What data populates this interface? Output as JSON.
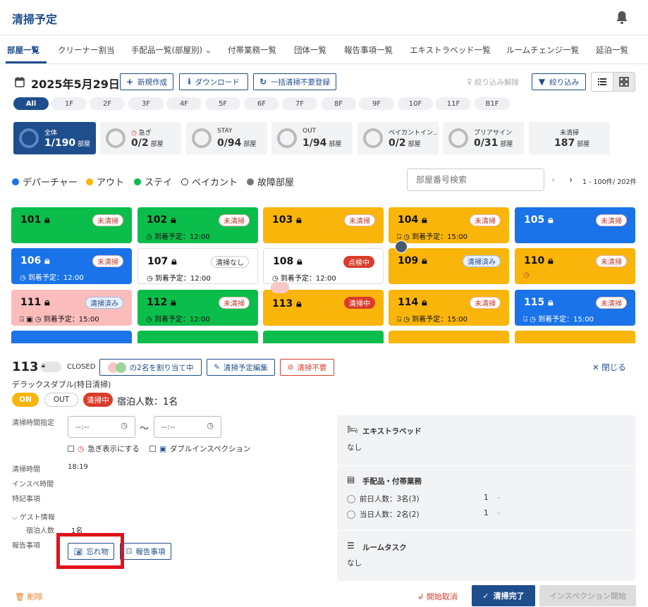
{
  "header": {
    "title": "清掃予定",
    "bell_icon": "bell-icon"
  },
  "tabs": [
    {
      "label": "部屋一覧"
    },
    {
      "label": "クリーナー割当"
    },
    {
      "label": "手配品一覧(部屋別)"
    },
    {
      "label": "付帯業務一覧"
    },
    {
      "label": "団体一覧"
    },
    {
      "label": "報告事項一覧"
    },
    {
      "label": "エキストラベッド一覧"
    },
    {
      "label": "ルームチェンジ一覧"
    },
    {
      "label": "延泊一覧"
    }
  ],
  "toolbar": {
    "date": "2025年5月29日",
    "new_label": "新規作成",
    "download_label": "ダウンロード",
    "bulk_label": "一括清掃不要登録",
    "filter_clear_label": "絞り込み解除",
    "filter_label": "絞り込み"
  },
  "floors": [
    "All",
    "1F",
    "2F",
    "3F",
    "4F",
    "5F",
    "6F",
    "7F",
    "8F",
    "9F",
    "10F",
    "11F",
    "B1F"
  ],
  "stats": [
    {
      "label": "全体",
      "value": "1/190",
      "unit": "部屋"
    },
    {
      "label": "急ぎ",
      "value": "0/2",
      "unit": "部屋"
    },
    {
      "label": "STAY",
      "value": "0/94",
      "unit": "部屋"
    },
    {
      "label": "OUT",
      "value": "1/94",
      "unit": "部屋"
    },
    {
      "label": "ベイカントイン…",
      "value": "0/2",
      "unit": "部屋"
    },
    {
      "label": "プリアサイン",
      "value": "0/31",
      "unit": "部屋"
    },
    {
      "label": "未清掃",
      "value": "187",
      "unit": "部屋"
    }
  ],
  "legend": [
    {
      "label": "デパーチャー",
      "color": "#1a73e8"
    },
    {
      "label": "アウト",
      "color": "#f9b509"
    },
    {
      "label": "ステイ",
      "color": "#0bbd4a"
    },
    {
      "label": "ベイカント",
      "color": "#ffffff"
    },
    {
      "label": "故障部屋",
      "color": "#777777"
    }
  ],
  "search": {
    "placeholder": "部屋番号検索"
  },
  "pager": {
    "label": "1 - 100件/ 202件"
  },
  "rooms": [
    {
      "num": "101",
      "badge": "未清掃",
      "sub": ""
    },
    {
      "num": "102",
      "badge": "未清掃",
      "sub": "到着予定：12:00"
    },
    {
      "num": "103",
      "badge": "未清掃",
      "sub": ""
    },
    {
      "num": "104",
      "badge": "未清掃",
      "sub": "到着予定：15:00"
    },
    {
      "num": "105",
      "badge": "未清掃",
      "sub": ""
    },
    {
      "num": "106",
      "badge": "未清掃",
      "sub": "到着予定：12:00"
    },
    {
      "num": "107",
      "badge": "清掃なし",
      "sub": "到着予定：12:00"
    },
    {
      "num": "108",
      "badge": "点検中",
      "sub": "到着予定：12:00"
    },
    {
      "num": "109",
      "badge": "清掃済み",
      "sub": ""
    },
    {
      "num": "110",
      "badge": "未清掃",
      "sub": ""
    },
    {
      "num": "111",
      "badge": "清掃済み",
      "sub": "到着予定：15:00"
    },
    {
      "num": "112",
      "badge": "未清掃",
      "sub": "到着予定：12:00"
    },
    {
      "num": "113",
      "badge": "清掃中",
      "sub": ""
    },
    {
      "num": "114",
      "badge": "未清掃",
      "sub": "到着予定：15:00"
    },
    {
      "num": "115",
      "badge": "未清掃",
      "sub": "到着予定：15:00"
    }
  ],
  "detail": {
    "room_num": "113",
    "closed_label": "CLOSED",
    "assign_label": "の2名を割り当て中",
    "edit_label": "清掃予定編集",
    "not_needed_label": "清掃不要",
    "close_label": "閉じる",
    "room_type": "デラックスダブル(特日清掃)",
    "on_label": "ON",
    "out_label": "OUT",
    "status_label": "清掃中",
    "guest_count": "宿泊人数：1名",
    "time_label": "清掃時間指定",
    "time_start": "--:--",
    "time_end": "--:--",
    "time_sep": "〜",
    "urgent_label": "急ぎ表示にする",
    "double_label": "ダブルインスペクション",
    "clean_time_label": "清掃時間",
    "clean_time_value": "18:19",
    "inspect_time_label": "インスペ時間",
    "notes_label": "特記事項",
    "guest_info_label": "ゲスト情報",
    "guests_label": "宿泊人数",
    "guests_value": "1名",
    "report_label": "報告事項",
    "lost_label": "忘れ物",
    "report_btn_label": "報告事項"
  },
  "info": {
    "extra_bed_title": "エキストラベッド",
    "extra_bed_value": "なし",
    "supplies_title": "手配品・付帯業務",
    "prev_day_label": "前日人数：3名(3)",
    "prev_day_count": "1",
    "prev_day_dash": "-",
    "today_label": "当日人数：2名(2)",
    "today_count": "1",
    "today_dash": "-",
    "task_title": "ルームタスク",
    "task_value": "なし"
  },
  "footer": {
    "delete_label": "削除",
    "cancel_start_label": "開始取消",
    "finish_label": "清掃完了",
    "inspect_label": "インスペクション開始"
  }
}
